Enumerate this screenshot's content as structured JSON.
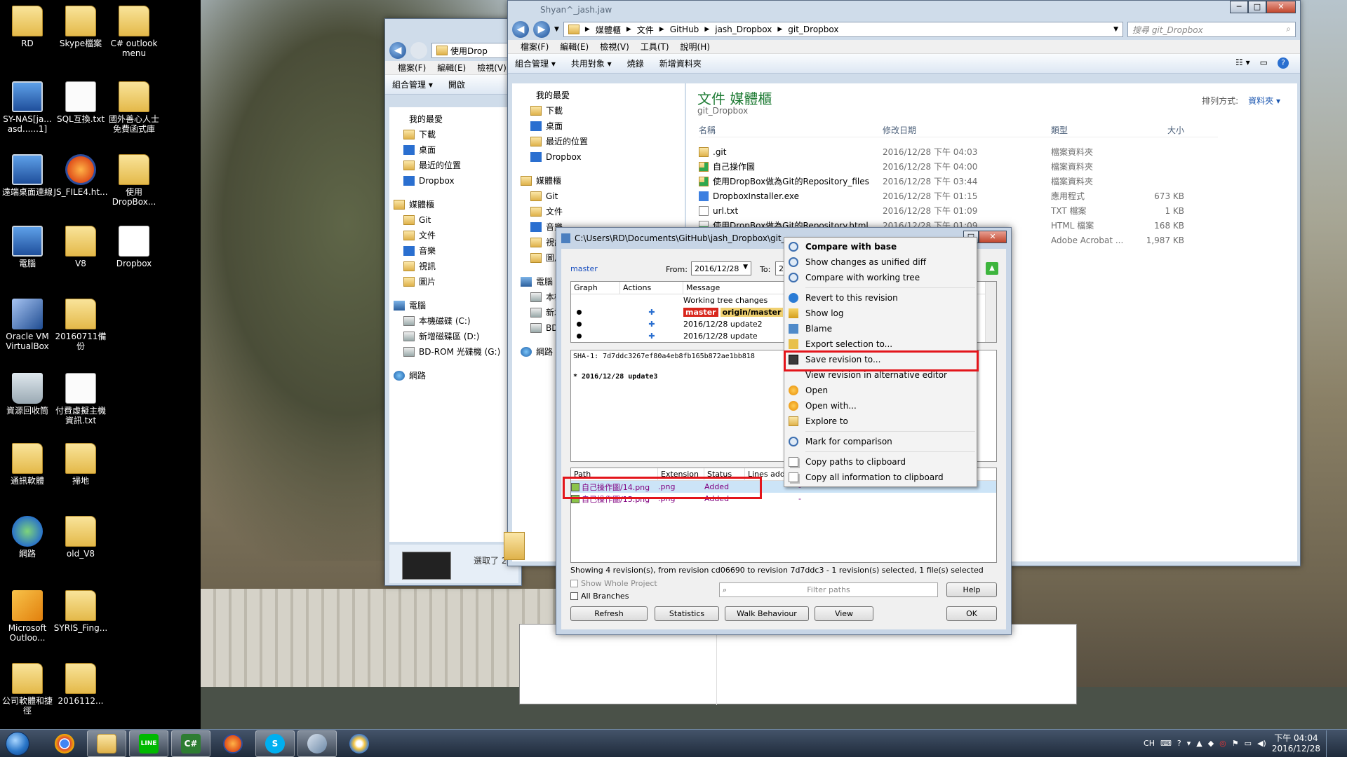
{
  "desktop": {
    "icons": [
      {
        "label": "RD",
        "type": "folder"
      },
      {
        "label": "Skype檔案",
        "type": "folder"
      },
      {
        "label": "C# outlook menu",
        "type": "folder"
      },
      {
        "label": "SY-NAS[ja... asd......1]",
        "type": "pc"
      },
      {
        "label": "SQL互換.txt",
        "type": "doc"
      },
      {
        "label": "國外善心人士免費函式庫",
        "type": "folder"
      },
      {
        "label": "遠端桌面連線",
        "type": "pc"
      },
      {
        "label": "JS_FILE4.ht...",
        "type": "ff"
      },
      {
        "label": "使用 DropBox...",
        "type": "folder"
      },
      {
        "label": "電腦",
        "type": "pc"
      },
      {
        "label": "V8",
        "type": "folder"
      },
      {
        "label": "Dropbox",
        "type": "db"
      },
      {
        "label": "Oracle VM VirtualBox",
        "type": "vb"
      },
      {
        "label": "20160711備份",
        "type": "folder"
      },
      {
        "label": "資源回收筒",
        "type": "bin"
      },
      {
        "label": "付費虛擬主機資訊.txt",
        "type": "doc"
      },
      {
        "label": "通訊軟體",
        "type": "folder"
      },
      {
        "label": "掃地",
        "type": "folder"
      },
      {
        "label": "網路",
        "type": "globe"
      },
      {
        "label": "old_V8",
        "type": "folder"
      },
      {
        "label": "Microsoft Outloo...",
        "type": "ol"
      },
      {
        "label": "SYRIS_Fing...",
        "type": "folder"
      },
      {
        "label": "公司軟體和捷徑",
        "type": "folder"
      },
      {
        "label": "2016112...",
        "type": "folder"
      }
    ]
  },
  "back_explorer": {
    "address": "使用Drop",
    "menu": [
      "檔案(F)",
      "編輯(E)",
      "檢視(V)"
    ],
    "commands": [
      "組合管理 ▾",
      "開啟"
    ],
    "nav": [
      "我的最愛",
      "下載",
      "桌面",
      "最近的位置",
      "Dropbox",
      "媒體櫃",
      "Git",
      "文件",
      "音樂",
      "視訊",
      "圖片",
      "電腦",
      "本機磁碟 (C:)",
      "新增磁碟區 (D:)",
      "BD-ROM 光碟機 (G:)",
      "網路"
    ],
    "status": "選取了 2"
  },
  "explorer": {
    "title": "Shyan^_jash.jaw",
    "breadcrumb": [
      "媒體櫃",
      "文件",
      "GitHub",
      "jash_Dropbox",
      "git_Dropbox"
    ],
    "search_placeholder": "搜尋 git_Dropbox",
    "menu": [
      "檔案(F)",
      "編輯(E)",
      "檢視(V)",
      "工具(T)",
      "說明(H)"
    ],
    "commands": [
      "組合管理 ▾",
      "共用對象 ▾",
      "燒錄",
      "新增資料夾"
    ],
    "nav": [
      "我的最愛",
      "下載",
      "桌面",
      "最近的位置",
      "Dropbox",
      "媒體櫃",
      "Git",
      "文件",
      "音樂",
      "視訊",
      "圖片",
      "電腦",
      "本機磁碟 (C:)",
      "新增磁碟區 (D:)",
      "BD-ROM 光碟機 (G:)",
      "網路"
    ],
    "library_title": "文件 媒體櫃",
    "library_sub": "git_Dropbox",
    "arrange_label": "排列方式:",
    "arrange_value": "資料夾 ▾",
    "columns": [
      "名稱",
      "修改日期",
      "類型",
      "大小"
    ],
    "files": [
      {
        "name": ".git",
        "date": "2016/12/28 下午 04:03",
        "type": "檔案資料夾",
        "size": "",
        "icon": "folder"
      },
      {
        "name": "自己操作圖",
        "date": "2016/12/28 下午 04:00",
        "type": "檔案資料夾",
        "size": "",
        "icon": "gfold"
      },
      {
        "name": "使用DropBox做為Git的Repository_files",
        "date": "2016/12/28 下午 03:44",
        "type": "檔案資料夾",
        "size": "",
        "icon": "gfold"
      },
      {
        "name": "DropboxInstaller.exe",
        "date": "2016/12/28 下午 01:15",
        "type": "應用程式",
        "size": "673 KB",
        "icon": "exe"
      },
      {
        "name": "url.txt",
        "date": "2016/12/28 下午 01:09",
        "type": "TXT 檔案",
        "size": "1 KB",
        "icon": "txt"
      },
      {
        "name": "使用DropBox做為Git的Repository.html",
        "date": "2016/12/28 下午 01:09",
        "type": "HTML 檔案",
        "size": "168 KB",
        "icon": "html"
      },
      {
        "name": "",
        "date": "",
        "type": "Adobe Acrobat ...",
        "size": "1,987 KB",
        "icon": "pdf"
      }
    ]
  },
  "log": {
    "title": "C:\\Users\\RD\\Documents\\GitHub\\jash_Dropbox\\git_",
    "branch": "master",
    "from_label": "From:",
    "from_value": "2016/12/28",
    "to_label": "To:",
    "to_value": "2",
    "columns": [
      "Graph",
      "Actions",
      "Message"
    ],
    "rows": [
      "Working tree changes",
      "20",
      "2016/12/28 update2",
      "2016/12/28 update"
    ],
    "tag_master": "master",
    "tag_origin": "origin/master",
    "sha": "SHA-1: 7d7ddc3267ef80a4eb8fb165b872ae1bb818",
    "commit_msg": "* 2016/12/28 update3",
    "file_columns": [
      "Path",
      "Extension",
      "Status",
      "Lines added"
    ],
    "files": [
      {
        "path": "自己操作圖/14.png",
        "ext": ".png",
        "status": "Added",
        "a": "-"
      },
      {
        "path": "自己操作圖/15.png",
        "ext": ".png",
        "status": "Added",
        "a": "-"
      }
    ],
    "summary": "Showing 4 revision(s), from revision cd06690 to revision 7d7ddc3 - 1 revision(s) selected, 1 file(s) selected",
    "show_whole": "Show Whole Project",
    "all_branches": "All Branches",
    "filter_placeholder": "Filter paths",
    "buttons": {
      "help": "Help",
      "refresh": "Refresh",
      "statistics": "Statistics",
      "walk": "Walk Behaviour",
      "view": "View",
      "ok": "OK"
    }
  },
  "context_menu": {
    "items": [
      {
        "label": "Compare with base",
        "icon": "mag",
        "bold": true
      },
      {
        "label": "Show changes as unified diff",
        "icon": "mag"
      },
      {
        "label": "Compare with working tree",
        "icon": "mag"
      },
      {
        "sep": true
      },
      {
        "label": "Revert to this revision",
        "icon": "rev"
      },
      {
        "label": "Show log",
        "icon": "log"
      },
      {
        "label": "Blame",
        "icon": "blm"
      },
      {
        "label": "Export selection to...",
        "icon": "exp"
      },
      {
        "label": "Save revision to...",
        "icon": "save"
      },
      {
        "label": "View revision in alternative editor",
        "icon": ""
      },
      {
        "label": "Open",
        "icon": "open"
      },
      {
        "label": "Open with...",
        "icon": "open"
      },
      {
        "label": "Explore to",
        "icon": "fold"
      },
      {
        "sep": true
      },
      {
        "label": "Mark for comparison",
        "icon": "mag"
      },
      {
        "sep": true
      },
      {
        "label": "Copy paths to clipboard",
        "icon": "copy"
      },
      {
        "label": "Copy all information to clipboard",
        "icon": "copy"
      }
    ]
  },
  "taskbar": {
    "apps": [
      "chrome",
      "explorer",
      "line",
      "csharp",
      "firefox",
      "skype",
      "git",
      "paint"
    ],
    "line_label": "LINE",
    "csharp_label": "C#",
    "tray_lang": "CH",
    "clock_time": "下午 04:04",
    "clock_date": "2016/12/28"
  }
}
